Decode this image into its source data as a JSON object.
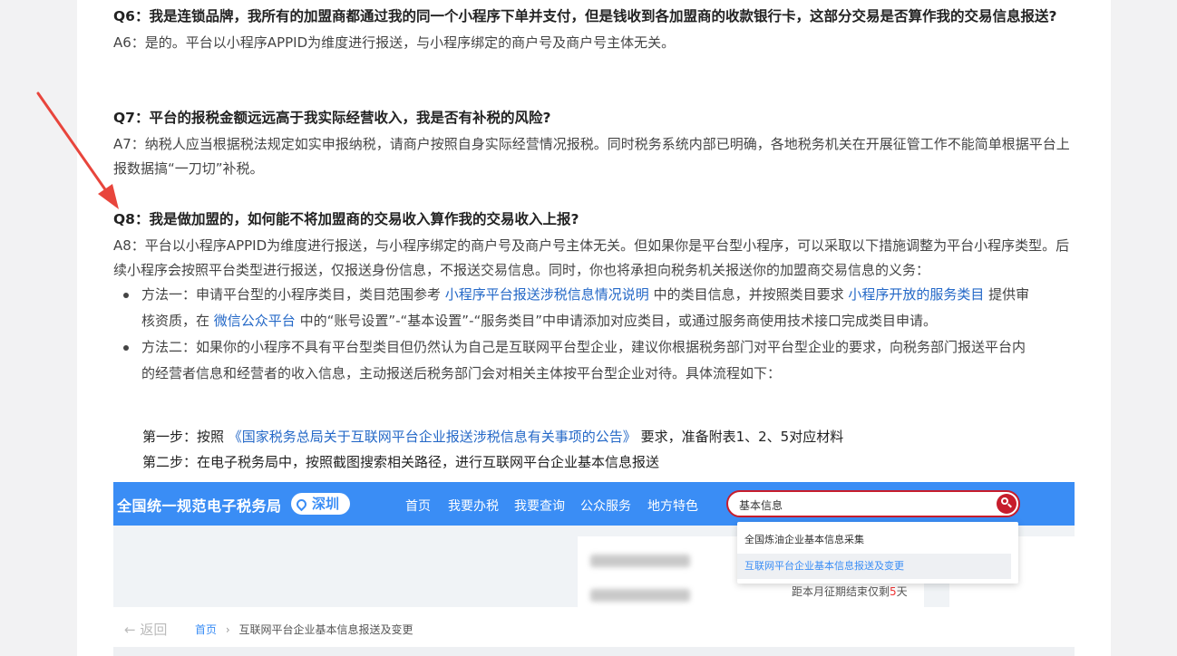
{
  "q6": {
    "question": "Q6：我是连锁品牌，我所有的加盟商都通过我的同一个小程序下单并支付，但是钱收到各加盟商的收款银行卡，这部分交易是否算作我的交易信息报送?",
    "answer": "A6：是的。平台以小程序APPID为维度进行报送，与小程序绑定的商户号及商户号主体无关。"
  },
  "q7": {
    "question": "Q7：平台的报税金额远远高于我实际经营收入，我是否有补税的风险?",
    "answer": "A7：纳税人应当根据税法规定如实申报纳税，请商户按照自身实际经营情况报税。同时税务系统内部已明确，各地税务机关在开展征管工作不能简单根据平台上报数据搞“一刀切”补税。"
  },
  "q8": {
    "question": "Q8：我是做加盟的，如何能不将加盟商的交易收入算作我的交易收入上报?",
    "answer": "A8：平台以小程序APPID为维度进行报送，与小程序绑定的商户号及商户号主体无关。但如果你是平台型小程序，可以采取以下措施调整为平台小程序类型。后续小程序会按照平台类型进行报送，仅报送身份信息，不报送交易信息。同时，你也将承担向税务机关报送你的加盟商交易信息的义务："
  },
  "method1": {
    "t1": "方法一：申请平台型的小程序类目，类目范围参考 ",
    "link1": "小程序平台报送涉税信息情况说明",
    "t2": " 中的类目信息，并按照类目要求 ",
    "link2": "小程序开放的服务类目",
    "t3": " 提供审核资质，在 ",
    "link3": "微信公众平台",
    "t4": " 中的“账号设置”-“基本设置”-“服务类目”中申请添加对应类目，或通过服务商使用技术接口完成类目申请。"
  },
  "method2": "方法二：如果你的小程序不具有平台型类目但仍然认为自己是互联网平台型企业，建议你根据税务部门对平台型企业的要求，向税务部门报送平台内的经营者信息和经营者的收入信息，主动报送后税务部门会对相关主体按平台型企业对待。具体流程如下：",
  "step1": {
    "t1": "第一步：按照 ",
    "link": "《国家税务总局关于互联网平台企业报送涉税信息有关事项的公告》",
    "t2": " 要求，准备附表1、2、5对应材料"
  },
  "step2": "第二步：在电子税务局中，按照截图搜索相关路径，进行互联网平台企业基本信息报送",
  "screenshot": {
    "brand": "全国统一规范电子税务局",
    "city": "深圳",
    "nav": [
      "首页",
      "我要办税",
      "我要查询",
      "公众服务",
      "地方特色"
    ],
    "search_value": "基本信息",
    "dropdown": [
      "全国炼油企业基本信息采集",
      "互联网平台企业基本信息报送及变更"
    ],
    "deadline_prefix": "距本月征期结束仅剩",
    "deadline_num": "5",
    "deadline_suffix": "天",
    "back": "返回",
    "breadcrumb_home": "首页",
    "breadcrumb_sep": "›",
    "breadcrumb_current": "互联网平台企业基本信息报送及变更",
    "colors": {
      "bar": "#3a8df5",
      "search_border": "#c71d2c",
      "highlight": "#3a8df5"
    }
  },
  "annotation": {
    "arrow_color": "#e8453c",
    "icon": "arrow-annotation"
  }
}
